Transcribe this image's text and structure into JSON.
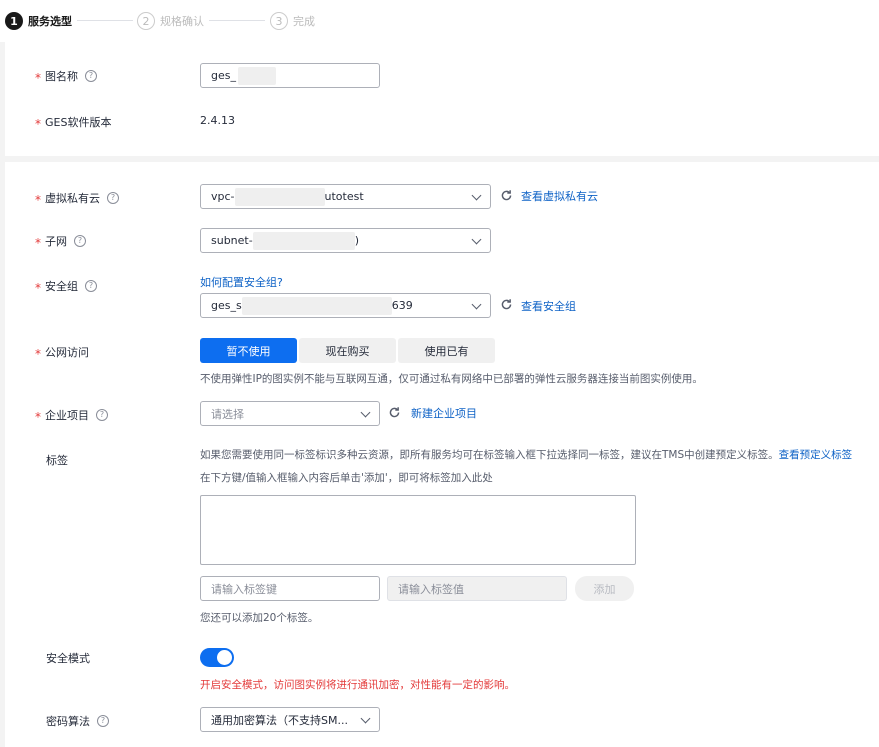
{
  "steps": [
    {
      "num": "1",
      "label": "服务选型"
    },
    {
      "num": "2",
      "label": "规格确认"
    },
    {
      "num": "3",
      "label": "完成"
    }
  ],
  "basic": {
    "name_label": "图名称",
    "name_value": "ges_",
    "version_label": "GES软件版本",
    "version_value": "2.4.13"
  },
  "network": {
    "vpc_label": "虚拟私有云",
    "vpc_prefix": "vpc-",
    "vpc_suffix": "utotest",
    "vpc_link": "查看虚拟私有云",
    "subnet_label": "子网",
    "subnet_prefix": "subnet-",
    "subnet_suffix": ")",
    "sg_label": "安全组",
    "sg_howto": "如何配置安全组?",
    "sg_prefix": "ges_s",
    "sg_suffix": "639",
    "sg_link": "查看安全组"
  },
  "public_access": {
    "label": "公网访问",
    "options": [
      "暂不使用",
      "现在购买",
      "使用已有"
    ],
    "selected": "暂不使用",
    "hint": "不使用弹性IP的图实例不能与互联网互通，仅可通过私有网络中已部署的弹性云服务器连接当前图实例使用。"
  },
  "enterprise": {
    "label": "企业项目",
    "placeholder": "请选择",
    "link": "新建企业项目"
  },
  "tags": {
    "label": "标签",
    "hint1": "如果您需要使用同一标签标识多种云资源，即所有服务均可在标签输入框下拉选择同一标签，建议在TMS中创建预定义标签。",
    "hint1_link": "查看预定义标签",
    "hint2": "在下方键/值输入框输入内容后单击'添加'，即可将标签加入此处",
    "key_placeholder": "请输入标签键",
    "value_placeholder": "请输入标签值",
    "add_button": "添加",
    "remaining": "您还可以添加20个标签。"
  },
  "security_mode": {
    "label": "安全模式",
    "enabled": true,
    "warning": "开启安全模式，访问图实例将进行通讯加密，对性能有一定的影响。"
  },
  "crypto": {
    "label": "密码算法",
    "value": "通用加密算法（不支持SM..."
  },
  "colors": {
    "primary": "#0d6ef0",
    "link": "#0e62c6",
    "required": "#e33a3a"
  }
}
